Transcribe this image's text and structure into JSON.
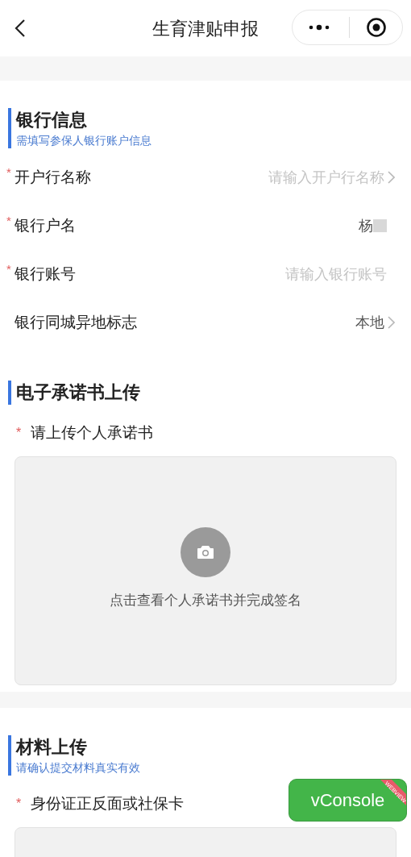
{
  "nav": {
    "title": "生育津贴申报"
  },
  "sections": [
    {
      "title": "银行信息",
      "subtitle": "需填写参保人银行账户信息",
      "items": [
        {
          "kind": "field",
          "label": "开户行名称",
          "marker": "*",
          "placeholder": "请输入开户行名称",
          "chevron": true
        },
        {
          "kind": "field",
          "label": "银行户名",
          "marker": "*",
          "value": "杨",
          "redacted": true
        },
        {
          "kind": "field",
          "label": "银行账号",
          "marker": "*",
          "placeholder": "请输入银行账号"
        },
        {
          "kind": "field",
          "label": "银行同城异地标志",
          "value": "本地",
          "chevron": true
        }
      ]
    },
    {
      "title": "电子承诺书上传",
      "items": [
        {
          "kind": "upload",
          "label": "请上传个人承诺书",
          "marker": "*",
          "hint": "点击查看个人承诺书并完成签名"
        }
      ]
    },
    {
      "title": "材料上传",
      "subtitle": "请确认提交材料真实有效",
      "items": [
        {
          "kind": "upload",
          "label": "身份证正反面或社保卡",
          "marker": "*"
        }
      ]
    }
  ],
  "vconsole": {
    "label": "vConsole",
    "ribbon": "WEBVIEW"
  }
}
